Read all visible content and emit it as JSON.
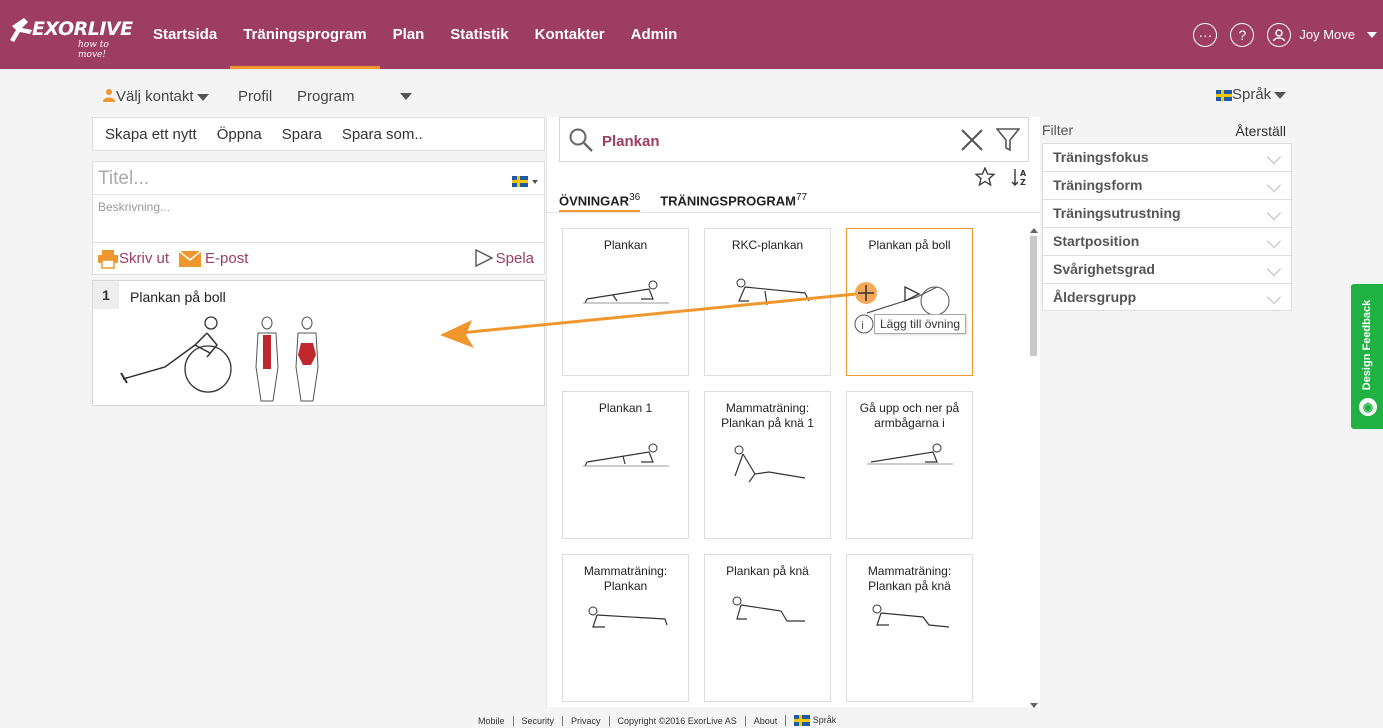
{
  "brand": {
    "name": "EXORLIVE",
    "tagline": "how to move!"
  },
  "nav": {
    "items": [
      "Startsida",
      "Träningsprogram",
      "Plan",
      "Statistik",
      "Kontakter",
      "Admin"
    ],
    "active": "Träningsprogram"
  },
  "user": {
    "name": "Joy Move"
  },
  "subbar": {
    "contact": "Välj kontakt",
    "profile": "Profil",
    "program": "Program",
    "language": "Språk"
  },
  "program_toolbar": {
    "new": "Skapa ett nytt",
    "open": "Öppna",
    "save": "Spara",
    "save_as": "Spara som.."
  },
  "program_form": {
    "title_placeholder": "Titel...",
    "description_placeholder": "Beskrivning..."
  },
  "program_actions": {
    "print": "Skriv ut",
    "email": "E-post",
    "play": "Spela"
  },
  "selected_exercises": [
    {
      "number": "1",
      "name": "Plankan på boll"
    }
  ],
  "search": {
    "query": "Plankan"
  },
  "tabs": [
    {
      "label": "ÖVNINGAR",
      "count": "36"
    },
    {
      "label": "TRÄNINGSPROGRAM",
      "count": "77"
    }
  ],
  "exercises": [
    {
      "name": "Plankan"
    },
    {
      "name": "RKC-plankan"
    },
    {
      "name": "Plankan på boll"
    },
    {
      "name": "Plankan 1"
    },
    {
      "name": "Mammaträning: Plankan på knä 1"
    },
    {
      "name": "Gå upp och ner på armbågarna i"
    },
    {
      "name": "Mammaträning: Plankan"
    },
    {
      "name": "Plankan på knä"
    },
    {
      "name": "Mammaträning: Plankan på knä"
    }
  ],
  "tooltip": {
    "text": "Lägg till övning"
  },
  "filter": {
    "label": "Filter",
    "reset": "Återställ",
    "items": [
      "Träningsfokus",
      "Träningsform",
      "Träningsutrustning",
      "Startposition",
      "Svårighetsgrad",
      "Åldersgrupp"
    ]
  },
  "feedback": {
    "label": "Design Feedback"
  },
  "footer": {
    "links": [
      "Mobile",
      "Security",
      "Privacy",
      "Copyright ©2016 ExorLive AS",
      "About",
      "Språk"
    ]
  },
  "colors": {
    "brand": "#9e3d62",
    "accent": "#f0962f",
    "feedback": "#1fb141"
  }
}
